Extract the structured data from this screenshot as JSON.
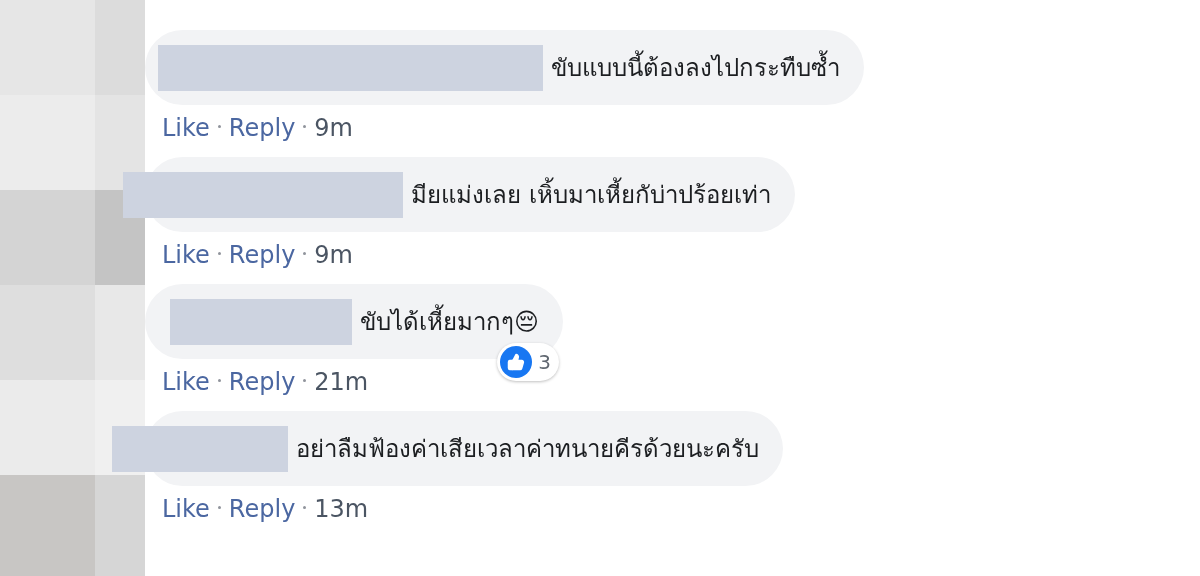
{
  "comments": [
    {
      "text": "ขับแบบนี้ต้องลงไปกระทืบซ้ำ",
      "actions": [
        "Like",
        "Reply"
      ],
      "time": "9m"
    },
    {
      "text": "มียแม่งเลย เหิ้บมาเหี้ยกับ่าปร้อยเท่า",
      "actions": [
        "Like",
        "Reply"
      ],
      "time": "9m"
    },
    {
      "text": "ขับได้เหี้ยมากๆ😔",
      "actions": [
        "Like",
        "Reply"
      ],
      "time": "21m",
      "reactions": {
        "count": "3"
      }
    },
    {
      "text": "อย่าลืมฟ้องค่าเสียเวลาค่าทนายคีรด้วยนะครับ",
      "actions": [
        "Like",
        "Reply"
      ],
      "time": "13m"
    }
  ]
}
